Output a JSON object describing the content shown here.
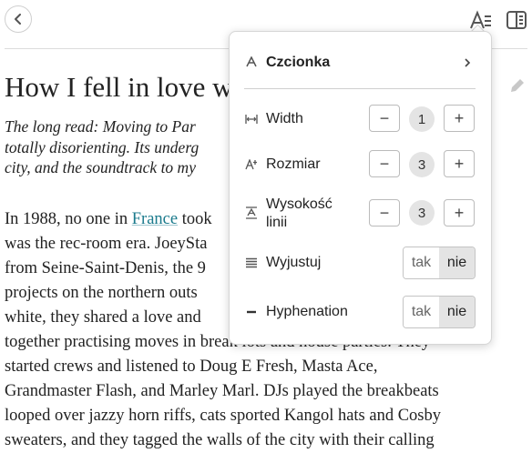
{
  "article": {
    "title": "How I fell in love w",
    "standfirst_lines": [
      "The long read: Moving to Par                              was",
      "totally disorienting. Its underg                          o the",
      "city, and the soundtrack to my"
    ],
    "body": {
      "line1_pre": "In 1988, no one in ",
      "line1_link": "France",
      "line1_post": " took                                                 It",
      "lines": [
        "was the rec-room era. JoeySta                                   ds",
        "from Seine-Saint-Denis, the 9                                  sing",
        "projects on the northern outs",
        "white, they shared a love and",
        "together practising moves in break lots and house parties. They",
        "started crews and listened to Doug E Fresh, Masta Ace,",
        "Grandmaster Flash, and Marley Marl. DJs played the breakbeats",
        "looped over jazzy horn riffs, cats sported Kangol hats and Cosby",
        "sweaters, and they tagged the walls of the city with their calling"
      ]
    }
  },
  "settings": {
    "font_label": "Czcionka",
    "width": {
      "label": "Width",
      "value": "1",
      "minus": "−",
      "plus": "+"
    },
    "size": {
      "label": "Rozmiar",
      "value": "3",
      "minus": "−",
      "plus": "+"
    },
    "line_height": {
      "label_line1": "Wysokość",
      "label_line2": "linii",
      "value": "3",
      "minus": "−",
      "plus": "+"
    },
    "justify": {
      "label": "Wyjustuj",
      "yes": "tak",
      "no": "nie",
      "selected": "nie"
    },
    "hyphenation": {
      "label": "Hyphenation",
      "yes": "tak",
      "no": "nie",
      "selected": "nie"
    }
  },
  "icons": [
    "chevron-left-icon",
    "text-settings-icon",
    "reader-layout-icon",
    "pencil-icon",
    "font-icon",
    "chevron-right-icon",
    "width-icon",
    "size-icon",
    "line-height-icon",
    "justify-icon",
    "hyphenation-icon"
  ]
}
